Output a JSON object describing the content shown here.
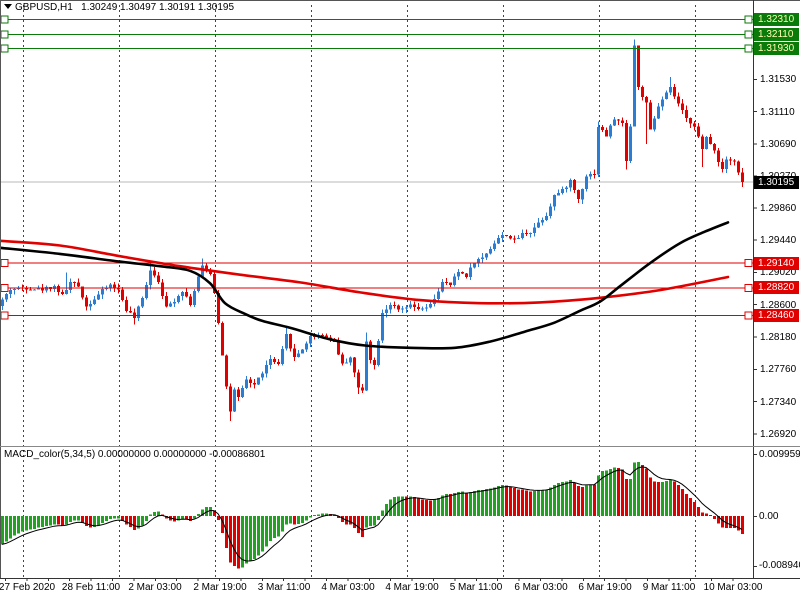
{
  "window": {
    "symbol_header": "GBPUSD,H1   1.30249 1.30497 1.30191 1.30195",
    "indicator_header": "MACD_color(5,34,5) 0.00000000 0.00000000 -0.00086801"
  },
  "colors": {
    "up_candle": "#2b7cd3",
    "down_candle": "#e00000",
    "line_red": "#e00000",
    "line_green": "#0a7a0a",
    "ma_red": "#e00000",
    "ma_black": "#000000",
    "macd_green": "#22a122",
    "macd_red": "#e00000",
    "signal_line": "#000000",
    "current_price_line": "#b9b9b9",
    "badge_text": "#ffffff",
    "green_badge_text": "#ffffb0",
    "frame": "#555555"
  },
  "chart_data": {
    "type": "candlestick",
    "symbol": "GBPUSD",
    "timeframe": "H1",
    "current_bar": {
      "open": 1.30249,
      "high": 1.30497,
      "low": 1.30191,
      "close": 1.30195
    },
    "x_labels": [
      "27 Feb 2020",
      "28 Feb 11:00",
      "2 Mar 03:00",
      "2 Mar 19:00",
      "3 Mar 11:00",
      "4 Mar 03:00",
      "4 Mar 19:00",
      "5 Mar 11:00",
      "6 Mar 03:00",
      "6 Mar 19:00",
      "9 Mar 11:00",
      "10 Mar 03:00"
    ],
    "price_ticks": [
      "1.31530",
      "1.31110",
      "1.30690",
      "1.30270",
      "1.29860",
      "1.29440",
      "1.29020",
      "1.28600",
      "1.28180",
      "1.27760",
      "1.27340",
      "1.26920"
    ],
    "hlines": {
      "green_levels": [
        "1.32310",
        "1.32110",
        "1.31930"
      ],
      "red_levels": [
        "1.29140",
        "1.28820",
        "1.28460"
      ],
      "current_price": "1.30195"
    },
    "close_anchors": [
      [
        0,
        1.2866
      ],
      [
        2,
        1.288
      ],
      [
        6,
        1.2882
      ],
      [
        10,
        1.288
      ],
      [
        13,
        1.2884
      ],
      [
        15,
        1.2872
      ],
      [
        17,
        1.2889
      ],
      [
        19,
        1.2884
      ],
      [
        21,
        1.2858
      ],
      [
        23,
        1.2868
      ],
      [
        25,
        1.2878
      ],
      [
        27,
        1.2886
      ],
      [
        29,
        1.2879
      ],
      [
        31,
        1.2854
      ],
      [
        33,
        1.2843
      ],
      [
        35,
        1.2868
      ],
      [
        37,
        1.2906
      ],
      [
        39,
        1.2891
      ],
      [
        41,
        1.2856
      ],
      [
        43,
        1.2866
      ],
      [
        45,
        1.2879
      ],
      [
        47,
        1.2861
      ],
      [
        49,
        1.2896
      ],
      [
        50,
        1.2909
      ],
      [
        52,
        1.2901
      ],
      [
        53,
        1.2876
      ],
      [
        54,
        1.2838
      ],
      [
        55,
        1.2796
      ],
      [
        56,
        1.2753
      ],
      [
        57,
        1.2722
      ],
      [
        58,
        1.2748
      ],
      [
        59,
        1.2738
      ],
      [
        61,
        1.2762
      ],
      [
        63,
        1.2756
      ],
      [
        65,
        1.2772
      ],
      [
        67,
        1.2789
      ],
      [
        69,
        1.2781
      ],
      [
        71,
        1.282
      ],
      [
        73,
        1.2791
      ],
      [
        75,
        1.2803
      ],
      [
        77,
        1.2818
      ],
      [
        79,
        1.2821
      ],
      [
        81,
        1.2819
      ],
      [
        83,
        1.2812
      ],
      [
        85,
        1.2782
      ],
      [
        87,
        1.2792
      ],
      [
        89,
        1.2751
      ],
      [
        90,
        1.2748
      ],
      [
        91,
        1.2814
      ],
      [
        92,
        1.279
      ],
      [
        93,
        1.2781
      ],
      [
        95,
        1.285
      ],
      [
        97,
        1.2861
      ],
      [
        99,
        1.2852
      ],
      [
        102,
        1.2858
      ],
      [
        105,
        1.2853
      ],
      [
        107,
        1.2859
      ],
      [
        110,
        1.2888
      ],
      [
        112,
        1.2886
      ],
      [
        114,
        1.2903
      ],
      [
        116,
        1.2898
      ],
      [
        118,
        1.2916
      ],
      [
        120,
        1.2921
      ],
      [
        122,
        1.2934
      ],
      [
        124,
        1.2947
      ],
      [
        126,
        1.2951
      ],
      [
        128,
        1.2943
      ],
      [
        130,
        1.2952
      ],
      [
        132,
        1.2955
      ],
      [
        134,
        1.2967
      ],
      [
        136,
        1.2977
      ],
      [
        138,
        1.3002
      ],
      [
        140,
        1.3008
      ],
      [
        142,
        1.3021
      ],
      [
        144,
        1.2997
      ],
      [
        146,
        1.3028
      ],
      [
        148,
        1.3031
      ],
      [
        149,
        1.3092
      ],
      [
        151,
        1.308
      ],
      [
        153,
        1.3102
      ],
      [
        155,
        1.3095
      ],
      [
        156,
        1.3049
      ],
      [
        157,
        1.3092
      ],
      [
        158,
        1.3197
      ],
      [
        159,
        1.3142
      ],
      [
        161,
        1.3121
      ],
      [
        162,
        1.3086
      ],
      [
        164,
        1.3118
      ],
      [
        166,
        1.3134
      ],
      [
        167,
        1.3141
      ],
      [
        169,
        1.3121
      ],
      [
        171,
        1.3101
      ],
      [
        173,
        1.3094
      ],
      [
        175,
        1.3061
      ],
      [
        176,
        1.3077
      ],
      [
        178,
        1.3062
      ],
      [
        179,
        1.3046
      ],
      [
        180,
        1.3037
      ],
      [
        181,
        1.3051
      ],
      [
        183,
        1.3046
      ],
      [
        184,
        1.3031
      ],
      [
        185,
        1.30195
      ]
    ],
    "wick_overrides": {
      "16": {
        "high": 1.2902
      },
      "33": {
        "low": 1.2834
      },
      "37": {
        "high": 1.2916
      },
      "50": {
        "high": 1.292
      },
      "57": {
        "low": 1.2709
      },
      "71": {
        "high": 1.283
      },
      "89": {
        "low": 1.2744
      },
      "91": {
        "high": 1.2824
      },
      "149": {
        "high": 1.3098
      },
      "156": {
        "low": 1.3036
      },
      "158": {
        "high": 1.3205
      },
      "161": {
        "low": 1.3069
      },
      "167": {
        "high": 1.3156
      },
      "175": {
        "low": 1.3039
      },
      "185": {
        "low": 1.3013
      }
    },
    "moving_averages": [
      {
        "name": "ma-red",
        "color": "#e00000",
        "points": [
          [
            0,
            1.2943
          ],
          [
            60,
            1.2937
          ],
          [
            120,
            1.2923
          ],
          [
            180,
            1.291
          ],
          [
            240,
            1.2899
          ],
          [
            300,
            1.2889
          ],
          [
            360,
            1.2876
          ],
          [
            420,
            1.2866
          ],
          [
            480,
            1.2862
          ],
          [
            540,
            1.2863
          ],
          [
            600,
            1.2869
          ],
          [
            660,
            1.2879
          ],
          [
            728,
            1.2896
          ]
        ]
      },
      {
        "name": "ma-black",
        "color": "#000000",
        "points": [
          [
            0,
            1.2934
          ],
          [
            60,
            1.2926
          ],
          [
            120,
            1.2916
          ],
          [
            160,
            1.291
          ],
          [
            190,
            1.2904
          ],
          [
            210,
            1.2888
          ],
          [
            225,
            1.2862
          ],
          [
            245,
            1.2848
          ],
          [
            262,
            1.2839
          ],
          [
            290,
            1.283
          ],
          [
            330,
            1.2815
          ],
          [
            365,
            1.2807
          ],
          [
            410,
            1.2804
          ],
          [
            455,
            1.2804
          ],
          [
            490,
            1.2812
          ],
          [
            525,
            1.2825
          ],
          [
            553,
            1.2836
          ],
          [
            580,
            1.2852
          ],
          [
            600,
            1.2864
          ],
          [
            620,
            1.2884
          ],
          [
            650,
            1.2914
          ],
          [
            680,
            1.294
          ],
          [
            705,
            1.2955
          ],
          [
            728,
            1.2967
          ]
        ]
      }
    ],
    "macd": {
      "name": "MACD_color",
      "params": [
        5,
        34,
        5
      ],
      "header_values": [
        "0.00000000",
        "0.00000000",
        "-0.00086801"
      ],
      "scale_labels": [
        "0.0099594",
        "0.00",
        "-0.0089400"
      ],
      "pos_max": 0.0088,
      "neg_min": -0.0086
    }
  }
}
